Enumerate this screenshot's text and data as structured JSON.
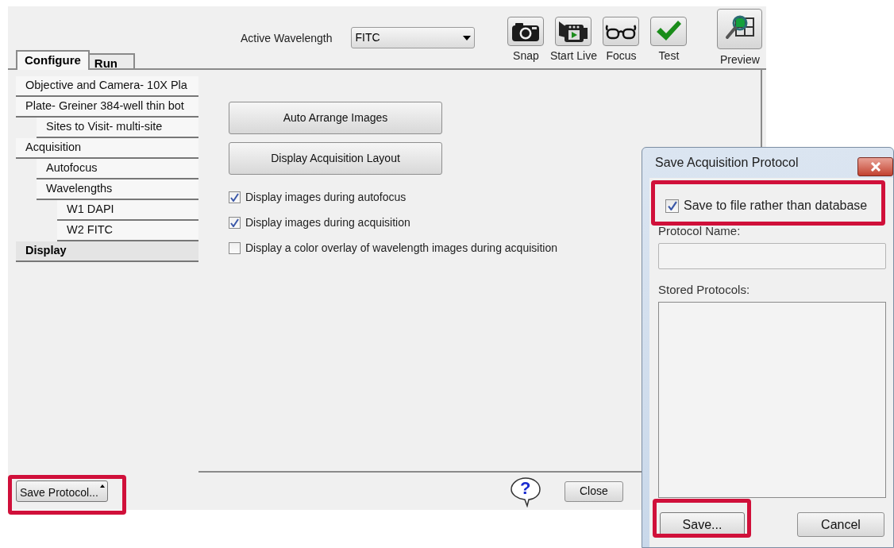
{
  "main_window": {
    "toolbar": {
      "active_wavelength_label": "Active Wavelength",
      "active_wavelength": "FITC",
      "tools": [
        {
          "kind": "camera",
          "label": "Snap"
        },
        {
          "kind": "video",
          "label": "Start Live"
        },
        {
          "kind": "glasses",
          "label": "Focus"
        },
        {
          "kind": "check",
          "label": "Test"
        }
      ],
      "preview": {
        "label": "Preview"
      }
    },
    "tabs": [
      {
        "label": "Configure",
        "selected": true
      },
      {
        "label": "Run",
        "selected": false
      }
    ],
    "tree": [
      {
        "label": "Objective and Camera- 10X Pla",
        "selected": false
      },
      {
        "label": "Plate- Greiner 384-well thin bot",
        "selected": false,
        "children": [
          {
            "label": "Sites to Visit- multi-site",
            "selected": false
          }
        ]
      },
      {
        "label": "Acquisition",
        "selected": false,
        "children": [
          {
            "label": "Autofocus",
            "selected": false
          },
          {
            "label": "Wavelengths",
            "selected": false,
            "children": [
              {
                "label": "W1 DAPI",
                "selected": false
              },
              {
                "label": "W2 FITC",
                "selected": false
              }
            ]
          }
        ]
      },
      {
        "label": "Display",
        "selected": true
      }
    ],
    "buttons": [
      "Auto Arrange Images",
      "Display Acquisition Layout"
    ],
    "options": [
      {
        "label": "Display images during autofocus",
        "checked": true
      },
      {
        "label": "Display images during acquisition",
        "checked": true
      },
      {
        "label": "Display a color overlay of wavelength images during acquisition",
        "checked": false
      }
    ],
    "save_protocol_button": {
      "label": "Save Protocol...",
      "highlighted": true
    },
    "help_button": {
      "label": "?"
    },
    "close_button": {
      "label": "Close"
    }
  },
  "dialog": {
    "title": "Save Acquisition Protocol",
    "save_to_file": {
      "label": "Save to file rather than database",
      "checked": true,
      "highlighted": true
    },
    "protocol_name_label": "Protocol Name:",
    "stored_protocols_label": "Stored Protocols:",
    "save_button": {
      "label": "Save...",
      "highlighted": true
    },
    "cancel_button": {
      "label": "Cancel"
    }
  }
}
